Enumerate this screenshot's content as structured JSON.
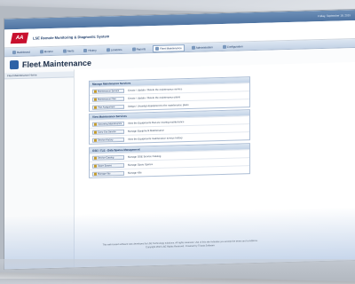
{
  "header": {
    "date_text": "Friday, September 18, 2015",
    "logo_text": "AA",
    "app_title": "LSE Remote Monitoring & Diagnostic System"
  },
  "nav": {
    "items": [
      {
        "label": "Dashboard",
        "active": false
      },
      {
        "label": "Monitor",
        "active": false
      },
      {
        "label": "Alerts",
        "active": false
      },
      {
        "label": "History",
        "active": false
      },
      {
        "label": "Locations",
        "active": false
      },
      {
        "label": "Reports",
        "active": false
      },
      {
        "label": "Fleet Maintenance",
        "active": true
      },
      {
        "label": "Administration",
        "active": false
      },
      {
        "label": "Configuration",
        "active": false
      }
    ]
  },
  "page": {
    "title": "Fleet Maintenance",
    "subtitle": "Home > Fleet Maintenance",
    "left_header": "Fleet Maintenance Home"
  },
  "sections": [
    {
      "title": "Manage Maintenance Services",
      "rows": [
        {
          "button": "Maintenance Service",
          "desc": "Create / Update / Delete the maintenance service"
        },
        {
          "button": "Maintenance Plan",
          "desc": "Create / Update / Delete the maintenance plans"
        },
        {
          "button": "Plan Assignment",
          "desc": "Assign / Unassign Equipment to the maintenance plans"
        }
      ]
    },
    {
      "title": "View Maintenance Services",
      "rows": [
        {
          "button": "Upcoming Maintenance",
          "desc": "View the Equipments that are nearing maintenance"
        },
        {
          "button": "Carry Out Service",
          "desc": "Manage Equipment Maintenance"
        },
        {
          "button": "Service History",
          "desc": "View the Equipments maintenance service history"
        }
      ]
    },
    {
      "title": "GSE / TLE - Data Spares Management",
      "rows": [
        {
          "button": "Service Catalog",
          "desc": "Manage GSE Service Catalog"
        },
        {
          "button": "Spare Spares",
          "desc": "Manage Spare Spares"
        },
        {
          "button": "Manage Kits",
          "desc": "Manage Kits"
        }
      ]
    }
  ],
  "footer": {
    "line1": "This web-based software was developed by LSE Technology solutions. All rights reserved. Use of this site indicates you accept the terms and conditions.",
    "line2": "Copyright 2015 LSE Rights Reserved. Powered by Triasta Software"
  }
}
